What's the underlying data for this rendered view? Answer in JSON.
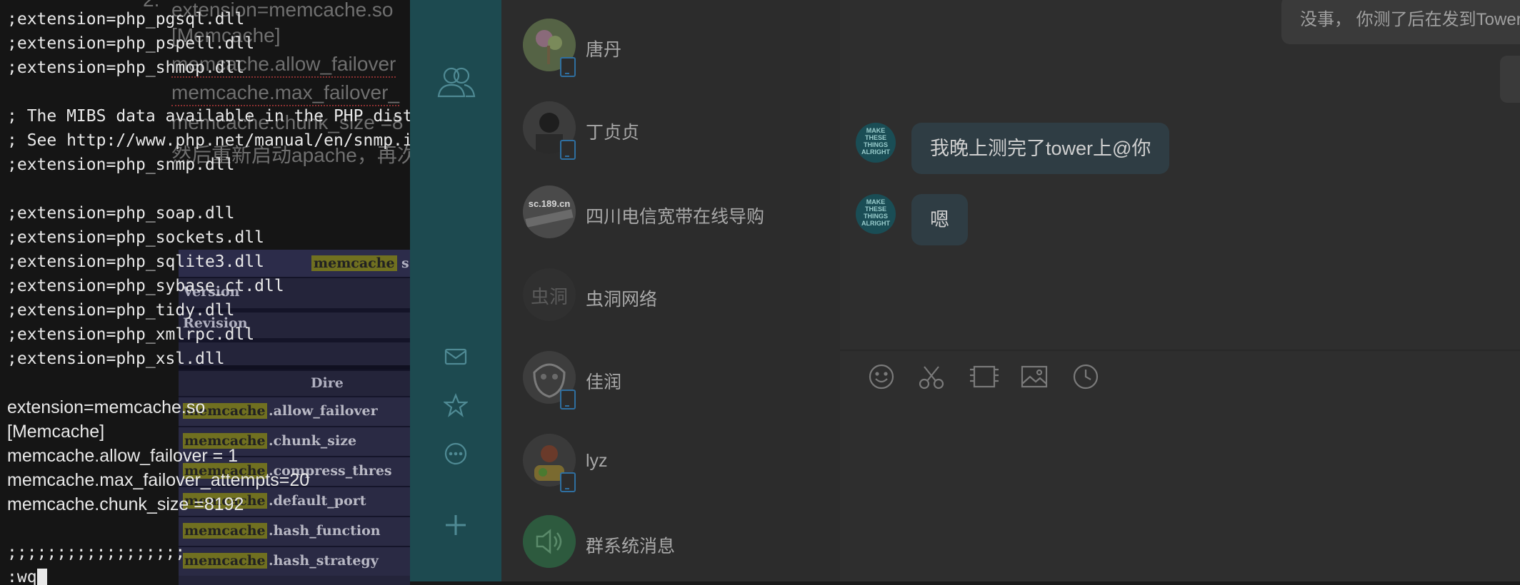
{
  "terminal": {
    "lines": [
      ";extension=php_pgsql.dll",
      ";extension=php_pspell.dll",
      ";extension=php_shmop.dll",
      "",
      "; The MIBS data available in the PHP distribution must be installed.",
      "; See http://www.php.net/manual/en/snmp.installation.php",
      ";extension=php_snmp.dll",
      "",
      ";extension=php_soap.dll",
      ";extension=php_sockets.dll",
      ";extension=php_sqlite3.dll",
      ";extension=php_sybase_ct.dll",
      ";extension=php_tidy.dll",
      ";extension=php_xmlrpc.dll",
      ";extension=php_xsl.dll",
      "",
      "extension=memcache.so",
      "[Memcache]",
      "memcache.allow_failover = 1",
      "memcache.max_failover_attempts=20",
      "memcache.chunk_size =8192",
      "",
      ";;;;;;;;;;;;;;;;;;",
      ":wq"
    ]
  },
  "background_doc": {
    "number": "2.",
    "lines": [
      "extension=memcache.so",
      "[Memcache]",
      "memcache.allow_failover",
      "memcache.max_failover_",
      "memcache.chunk_size =8",
      "然后重新启动apache，再次"
    ]
  },
  "php_table": {
    "title_highlight": "memcache",
    "title_rest": "s",
    "rows_top": [
      "Version",
      "Revision"
    ],
    "directive_header": "Dire",
    "highlight": "memcache",
    "rows": [
      ".allow_failover",
      ".chunk_size",
      ".compress_thres",
      ".default_port",
      ".hash_function",
      ".hash_strategy"
    ]
  },
  "sidebar": {
    "icons": [
      "contacts-icon",
      "mail-icon",
      "star-icon",
      "more-icon",
      "add-icon"
    ]
  },
  "conversations": [
    {
      "name": "唐丹",
      "mobile": true
    },
    {
      "name": "丁贞贞",
      "mobile": true
    },
    {
      "name": "四川电信宽带在线导购",
      "mobile": false,
      "avatar_text": "sc.189.cn"
    },
    {
      "name": "虫洞网络",
      "mobile": false,
      "avatar_text": "虫洞"
    },
    {
      "name": "佳润",
      "mobile": true
    },
    {
      "name": "lyz",
      "mobile": true
    },
    {
      "name": "群系统消息",
      "mobile": false
    }
  ],
  "chat": {
    "top_message": "没事， 你测了后在发到Tower上嘛",
    "messages": [
      {
        "text": "我晚上测完了tower上@你",
        "avatar_text": "MAKE THESE THINGS ALRIGHT"
      },
      {
        "text": "嗯",
        "avatar_text": "MAKE THESE THINGS ALRIGHT"
      }
    ],
    "toolbar": [
      "emoji-icon",
      "scissors-icon",
      "film-icon",
      "image-icon",
      "clock-icon"
    ]
  },
  "colors": {
    "sidebar": "#1d4a50",
    "terminal_bg": "#151515",
    "badge": "#2f6fa0"
  }
}
